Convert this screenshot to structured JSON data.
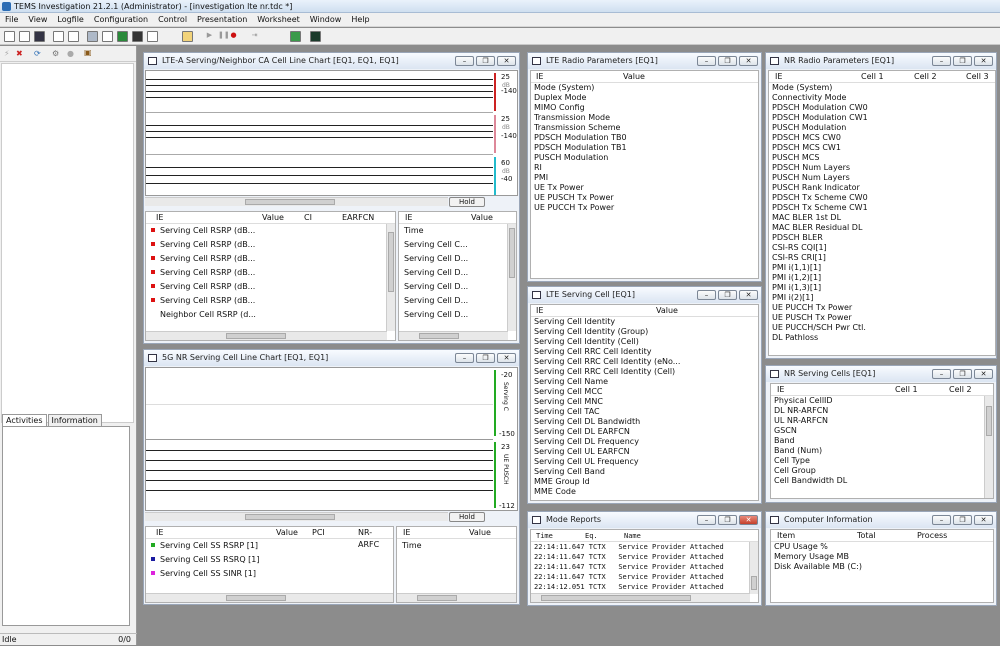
{
  "app": {
    "title": "TEMS Investigation 21.2.1 (Administrator) - [investigation lte nr.tdc *]"
  },
  "menu": [
    "File",
    "View",
    "Logfile",
    "Configuration",
    "Control",
    "Presentation",
    "Worksheet",
    "Window",
    "Help"
  ],
  "toolbar_icons": [
    "new-icon",
    "open-icon",
    "save-icon",
    "print-icon",
    "preview-icon",
    "equipment-icon",
    "replay-icon",
    "green-icon",
    "terminal-icon",
    "mail-icon",
    "folder-open-icon",
    "play-icon",
    "pause-icon",
    "record-icon",
    "export-icon",
    "map-icon",
    "chip-icon"
  ],
  "left": {
    "tabs": [
      "Activities",
      "Information"
    ],
    "status": "Idle",
    "count": "0/0"
  },
  "lte_chart": {
    "title": "LTE-A Serving/Neighbor CA Cell Line Chart [EQ1, EQ1, EQ1]",
    "hold": "Hold",
    "scales": [
      {
        "top": "25",
        "mid": "dB",
        "bot": "-140"
      },
      {
        "top": "25",
        "mid": "dB",
        "bot": "-140"
      },
      {
        "top": "60",
        "mid": "dB",
        "bot": "-40"
      }
    ],
    "left_cols": [
      "IE",
      "Value",
      "CI",
      "EARFCN"
    ],
    "left_rows": [
      "Serving Cell RSRP (dB...",
      "Serving Cell RSRP (dB...",
      "Serving Cell RSRP (dB...",
      "Serving Cell RSRP (dB...",
      "Serving Cell RSRP (dB...",
      "Serving Cell RSRP (dB...",
      "Neighbor Cell RSRP (d..."
    ],
    "right_cols": [
      "IE",
      "Value"
    ],
    "right_rows": [
      "Time",
      "Serving Cell C...",
      "Serving Cell D...",
      "Serving Cell D...",
      "Serving Cell D...",
      "Serving Cell D...",
      "Serving Cell D..."
    ]
  },
  "nr_chart": {
    "title": "5G NR Serving Cell Line Chart [EQ1, EQ1]",
    "hold": "Hold",
    "scales": [
      {
        "top": "-20",
        "mid": "Serving C",
        "bot": "-150"
      },
      {
        "top": "23",
        "mid": "UE PUSCH",
        "bot": "-112"
      }
    ],
    "left_cols": [
      "IE",
      "Value",
      "PCI",
      "NR-ARFC"
    ],
    "left_rows": [
      {
        "label": "Serving Cell SS RSRP [1]",
        "color": "#22aa22"
      },
      {
        "label": "Serving Cell SS RSRQ [1]",
        "color": "#1a1aa0"
      },
      {
        "label": "Serving Cell SS SINR [1]",
        "color": "#dd22dd"
      }
    ],
    "right_cols": [
      "IE",
      "Value"
    ],
    "right_rows": [
      "Time"
    ]
  },
  "lte_radio": {
    "title": "LTE Radio Parameters [EQ1]",
    "cols": [
      "IE",
      "Value"
    ],
    "rows": [
      "Mode (System)",
      "Duplex Mode",
      "MIMO Config",
      "Transmission Mode",
      "Transmission Scheme",
      "PDSCH Modulation TB0",
      "PDSCH Modulation TB1",
      "PUSCH Modulation",
      "RI",
      "PMI",
      "UE Tx Power",
      "UE PUSCH Tx Power",
      "UE PUCCH Tx Power"
    ]
  },
  "nr_radio": {
    "title": "NR Radio Parameters [EQ1]",
    "cols": [
      "IE",
      "Cell 1",
      "Cell 2",
      "Cell 3"
    ],
    "rows": [
      "Mode (System)",
      "Connectivity Mode",
      "PDSCH Modulation CW0",
      "PDSCH Modulation CW1",
      "PUSCH Modulation",
      "PDSCH MCS CW0",
      "PDSCH MCS CW1",
      "PUSCH MCS",
      "PDSCH Num Layers",
      "PUSCH Num Layers",
      "PUSCH Rank Indicator",
      "PDSCH Tx Scheme CW0",
      "PDSCH Tx Scheme CW1",
      "MAC BLER 1st DL",
      "MAC BLER Residual DL",
      "PDSCH BLER",
      "CSI-RS CQI[1]",
      "CSI-RS CRI[1]",
      "PMI i(1,1)[1]",
      "PMI i(1,2)[1]",
      "PMI i(1,3)[1]",
      "PMI i(2)[1]",
      "UE PUCCH Tx Power",
      "UE PUSCH Tx Power",
      "UE PUCCH/SCH Pwr Ctl.",
      "DL Pathloss"
    ]
  },
  "lte_cell": {
    "title": "LTE Serving Cell [EQ1]",
    "cols": [
      "IE",
      "Value"
    ],
    "rows": [
      "Serving Cell Identity",
      "Serving Cell Identity (Group)",
      "Serving Cell Identity (Cell)",
      "Serving Cell RRC Cell Identity",
      "Serving Cell RRC Cell Identity (eNo...",
      "Serving Cell RRC Cell Identity (Cell)",
      "Serving Cell Name",
      "Serving Cell MCC",
      "Serving Cell MNC",
      "Serving Cell TAC",
      "Serving Cell DL Bandwidth",
      "Serving Cell DL EARFCN",
      "Serving Cell DL Frequency",
      "Serving Cell UL EARFCN",
      "Serving Cell UL Frequency",
      "Serving Cell Band",
      "MME Group Id",
      "MME Code"
    ]
  },
  "nr_cells": {
    "title": "NR Serving Cells [EQ1]",
    "cols": [
      "IE",
      "Cell 1",
      "Cell 2"
    ],
    "rows": [
      "Physical CellID",
      "DL NR-ARFCN",
      "UL NR-ARFCN",
      "GSCN",
      "Band",
      "Band (Num)",
      "Cell Type",
      "Cell Group",
      "Cell Bandwidth DL"
    ]
  },
  "mode_reports": {
    "title": "Mode Reports",
    "cols": [
      "Time",
      "Eq.",
      "Name"
    ],
    "rows": [
      {
        "time": "22:14:11.647",
        "eq": "TCTX",
        "name": "Service Provider Attached"
      },
      {
        "time": "22:14:11.647",
        "eq": "TCTX",
        "name": "Service Provider Attached"
      },
      {
        "time": "22:14:11.647",
        "eq": "TCTX",
        "name": "Service Provider Attached"
      },
      {
        "time": "22:14:11.647",
        "eq": "TCTX",
        "name": "Service Provider Attached"
      },
      {
        "time": "22:14:12.051",
        "eq": "TCTX",
        "name": "Service Provider Attached"
      }
    ]
  },
  "computer_info": {
    "title": "Computer Information",
    "cols": [
      "Item",
      "Total",
      "Process"
    ],
    "rows": [
      "CPU Usage %",
      "Memory Usage MB",
      "Disk Available MB (C:)"
    ]
  },
  "colors": {
    "lane_red": "#cc2222",
    "lane_pink": "#dd8899",
    "lane_cyan": "#22bbcc",
    "lane_green": "#22aa22",
    "marker_red": "#dd1111"
  }
}
